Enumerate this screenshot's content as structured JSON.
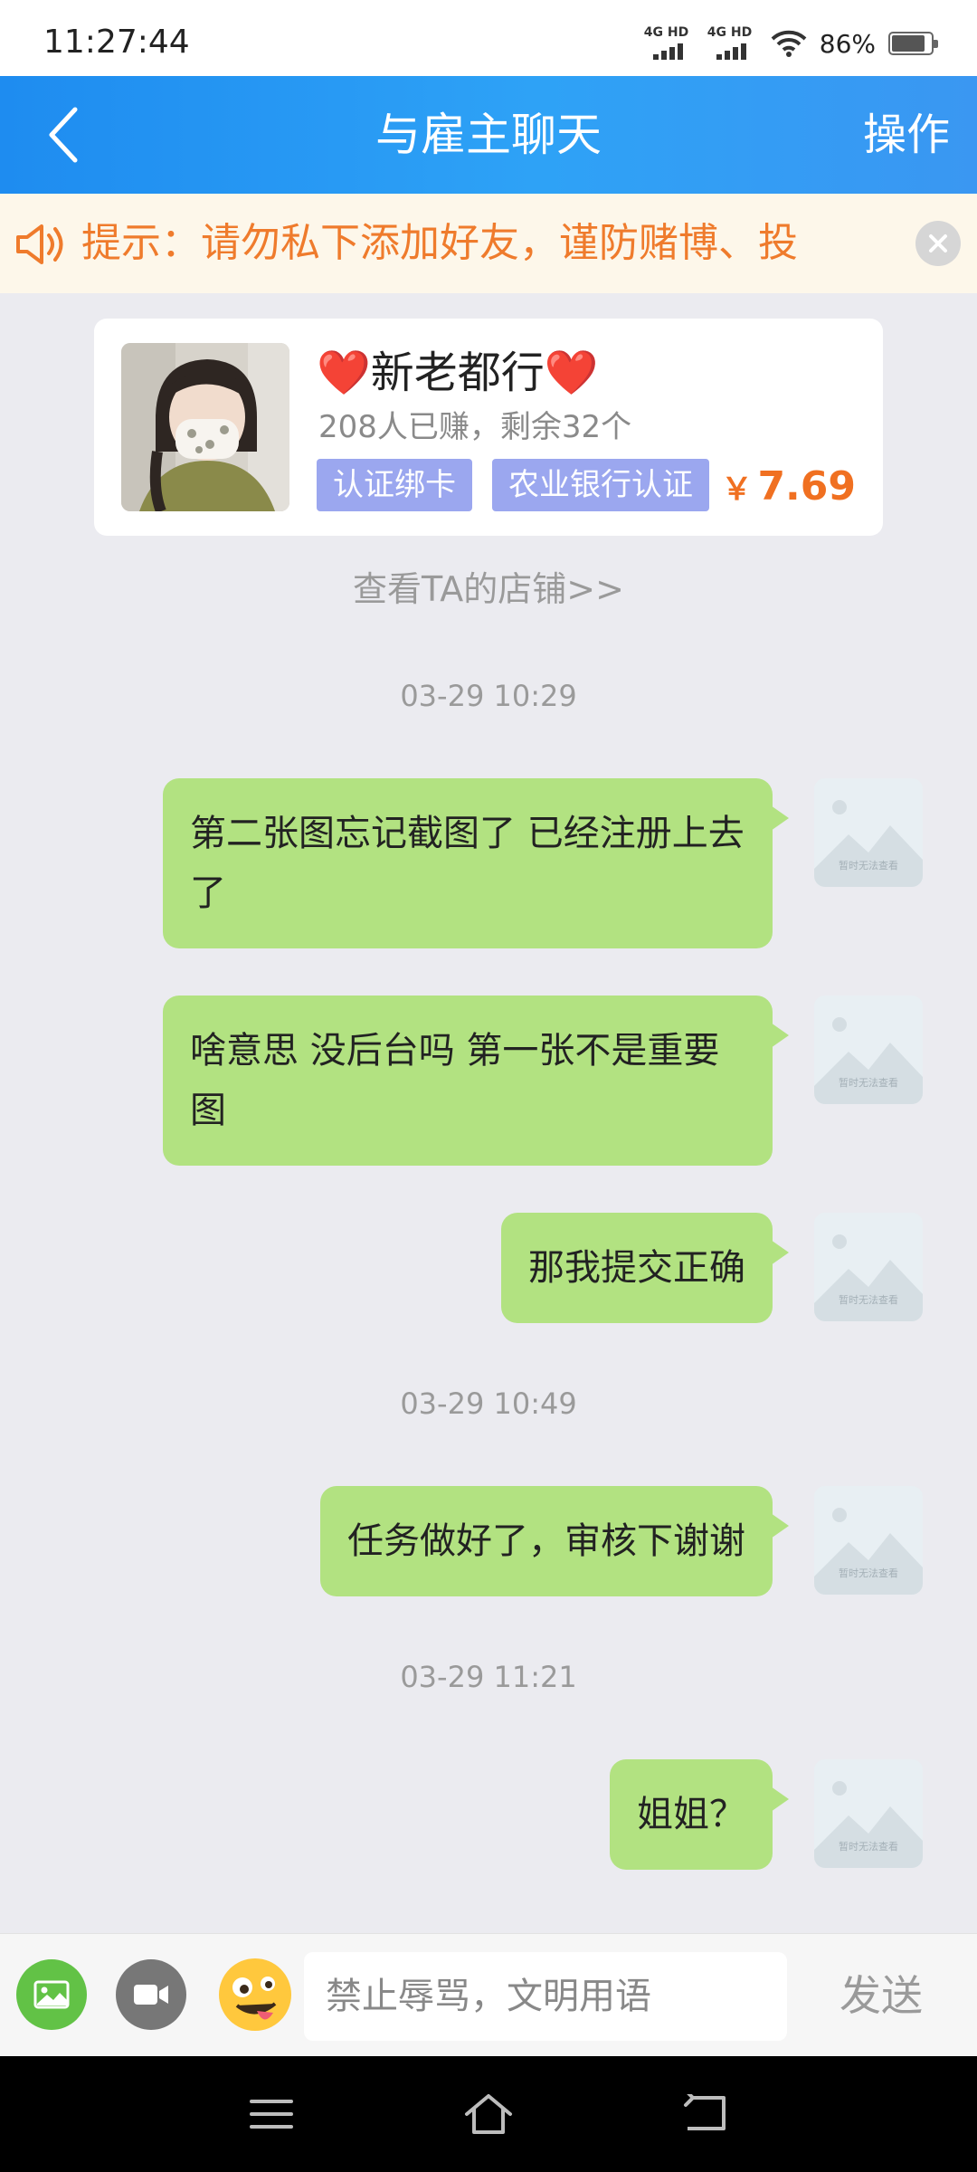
{
  "status_bar": {
    "time": "11:27:44",
    "network_1": "4G HD",
    "network_2": "4G HD",
    "battery": "86%",
    "battery_level": 0.86
  },
  "nav": {
    "back_icon": "chevron-left-icon",
    "title": "与雇主聊天",
    "action": "操作"
  },
  "notice": {
    "icon": "speaker-icon",
    "text": "提示：请勿私下添加好友，谨防赌博、投",
    "close_icon": "close-icon"
  },
  "task": {
    "title": "❤️新老都行❤️",
    "subtitle": "208人已赚，剩余32个",
    "tags": [
      "认证绑卡",
      "农业银行认证"
    ],
    "currency": "￥",
    "price": "7.69"
  },
  "shop_link": "查看TA的店铺>>",
  "messages": [
    {
      "type": "time",
      "text": "03-29 10:29"
    },
    {
      "type": "msg",
      "text": "第二张图忘记截图了 已经注册上去了"
    },
    {
      "type": "msg",
      "text": "啥意思 没后台吗 第一张不是重要图"
    },
    {
      "type": "msg",
      "text": "那我提交正确"
    },
    {
      "type": "time",
      "text": "03-29 10:49"
    },
    {
      "type": "msg",
      "text": "任务做好了，审核下谢谢"
    },
    {
      "type": "time",
      "text": "03-29 11:21"
    },
    {
      "type": "msg",
      "text": "姐姐？"
    }
  ],
  "avatar_placeholder_text": "暂时无法查看",
  "input_bar": {
    "image_icon": "image-icon",
    "video_icon": "video-camera-icon",
    "emoji_icon": "emoji-icon",
    "placeholder": "禁止辱骂，文明用语",
    "send": "发送"
  },
  "colors": {
    "nav_gradient_start": "#1e8cf0",
    "nav_gradient_end": "#3a97f2",
    "bubble": "#b2e281",
    "notice_text": "#ef7b2c",
    "tag_bg": "#9ba7ef",
    "price": "#f07021",
    "image_tool": "#62c246",
    "video_tool": "#777777"
  }
}
